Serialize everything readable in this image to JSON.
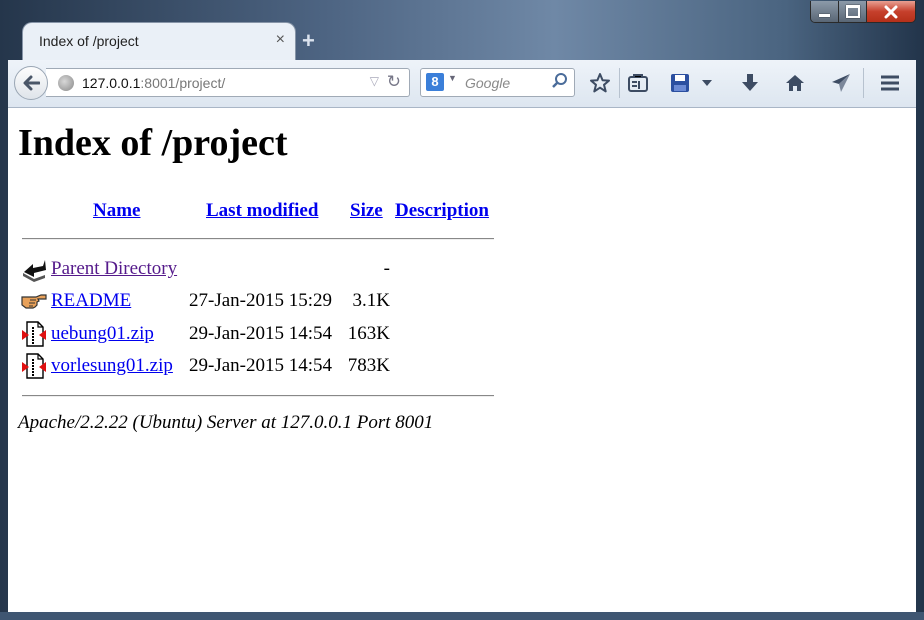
{
  "window": {
    "controls": {
      "minimize": "minimize",
      "maximize": "maximize",
      "close": "close"
    }
  },
  "tab": {
    "title": "Index of /project",
    "close": "×",
    "new_tab": "+"
  },
  "navbar": {
    "url_host": "127.0.0.1",
    "url_rest": ":8001/project/",
    "search_placeholder": "Google",
    "search_engine_letter": "8",
    "icons": [
      "back-icon",
      "globe-icon",
      "dropdown-icon",
      "reload-icon",
      "google-icon",
      "search-icon",
      "bookmark-star-icon",
      "reading-list-icon",
      "save-icon",
      "chevron-down-icon",
      "download-icon",
      "home-icon",
      "send-icon",
      "menu-icon"
    ]
  },
  "page": {
    "title": "Index of /project",
    "headers": {
      "name": "Name",
      "last_modified": "Last modified",
      "size": "Size",
      "description": "Description"
    },
    "rows": [
      {
        "name": "Parent Directory",
        "date": "",
        "size": "-",
        "icon": "back-folder-icon"
      },
      {
        "name": "README",
        "date": "27-Jan-2015 15:29",
        "size": "3.1K",
        "icon": "hand-icon"
      },
      {
        "name": "uebung01.zip",
        "date": "29-Jan-2015 14:54",
        "size": "163K",
        "icon": "zip-file-icon"
      },
      {
        "name": "vorlesung01.zip",
        "date": "29-Jan-2015 14:54",
        "size": "783K",
        "icon": "zip-file-icon"
      }
    ],
    "footer": "Apache/2.2.22 (Ubuntu) Server at 127.0.0.1 Port 8001"
  }
}
